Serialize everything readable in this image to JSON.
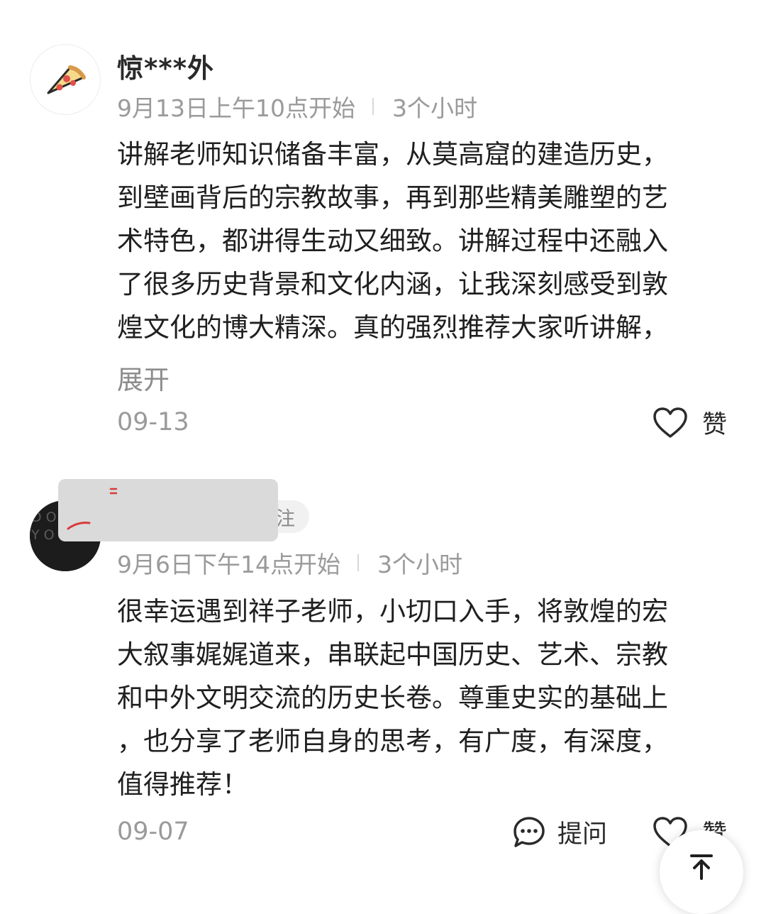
{
  "comments": [
    {
      "username": "惊***外",
      "schedule": "9月13日上午10点开始",
      "duration": "3个小时",
      "lines": [
        "讲解老师知识储备丰富，从莫高窟的建造历史，",
        "到壁画背后的宗教故事，再到那些精美雕塑的艺",
        "术特色，都讲得生动又细致。讲解过程中还融入",
        "了很多历史背景和文化内涵，让我深刻感受到敦",
        "煌文化的博大精深。真的强烈推荐大家听讲解，"
      ],
      "expand_label": "展开",
      "date": "09-13",
      "like_label": "赞"
    },
    {
      "follow_chip_label": "注",
      "schedule": "9月6日下午14点开始",
      "duration": "3个小时",
      "lines": [
        "很幸运遇到祥子老师，小切口入手，将敦煌的宏",
        "大叙事娓娓道来，串联起中国历史、艺术、宗教",
        "和中外文明交流的历史长卷。尊重史实的基础上",
        "，也分享了老师自身的思考，有广度，有深度，",
        "值得推荐！"
      ],
      "date": "09-07",
      "ask_label": "提问",
      "like_label": "赞"
    }
  ],
  "icons": {
    "avatar1": "pizza-slice-icon",
    "like": "heart-outline-icon",
    "ask": "chat-bubble-dots-icon",
    "scroll_top": "arrow-up-to-top-icon"
  }
}
